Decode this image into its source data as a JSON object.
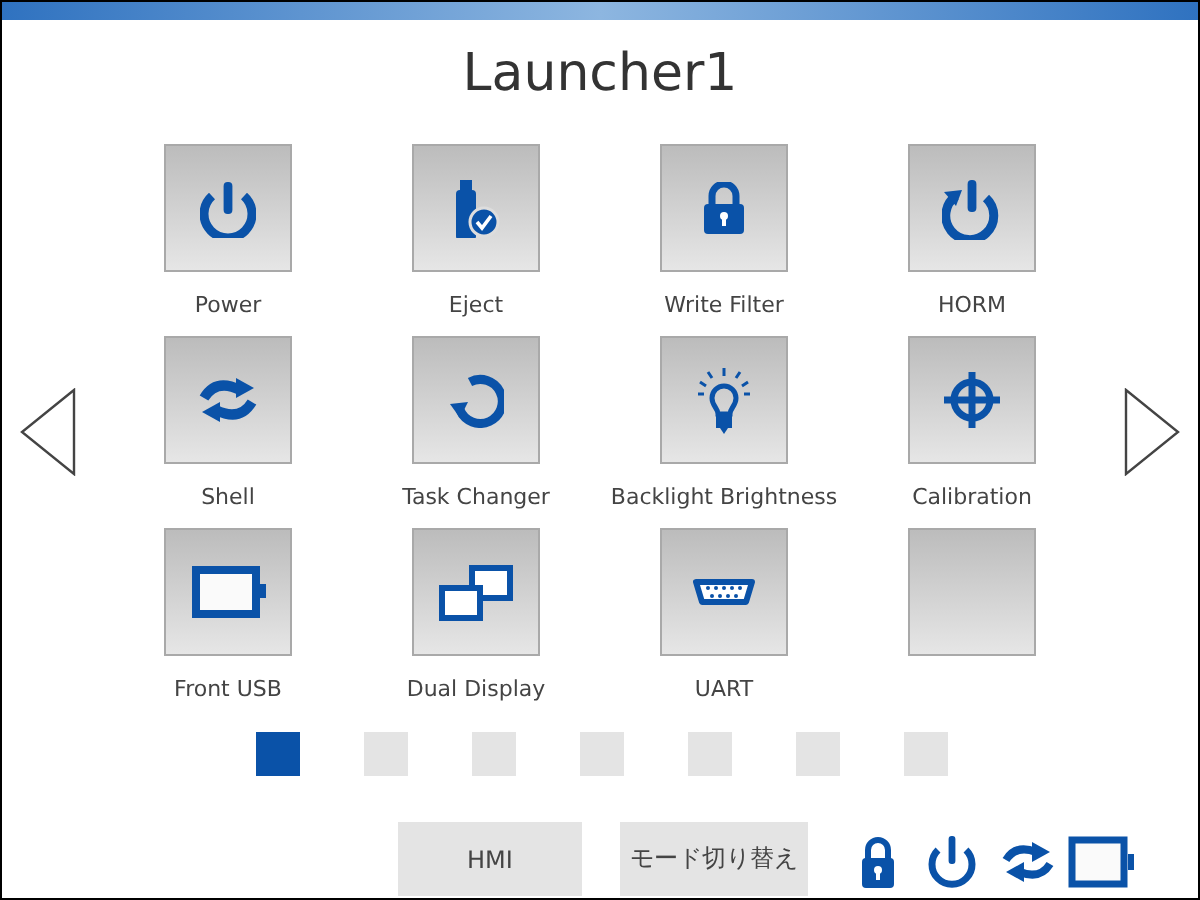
{
  "title": "Launcher1",
  "tiles": [
    {
      "kind": "app",
      "label": "Power"
    },
    {
      "kind": "app",
      "label": "Eject"
    },
    {
      "kind": "app",
      "label": "Write Filter"
    },
    {
      "kind": "app",
      "label": "HORM"
    },
    {
      "kind": "app",
      "label": "Shell"
    },
    {
      "kind": "app",
      "label": "Task Changer"
    },
    {
      "kind": "app",
      "label": "Backlight Brightness"
    },
    {
      "kind": "app",
      "label": "Calibration"
    },
    {
      "kind": "app",
      "label": "Front USB"
    },
    {
      "kind": "app",
      "label": "Dual Display"
    },
    {
      "kind": "app",
      "label": "UART"
    },
    {
      "kind": "empty"
    }
  ],
  "pages": [
    {
      "selected": true
    },
    {
      "selected": false
    },
    {
      "selected": false
    },
    {
      "selected": false
    },
    {
      "selected": false
    },
    {
      "selected": false
    },
    {
      "selected": false
    }
  ],
  "buttons": [
    "HMI",
    "モード切り替え"
  ]
}
